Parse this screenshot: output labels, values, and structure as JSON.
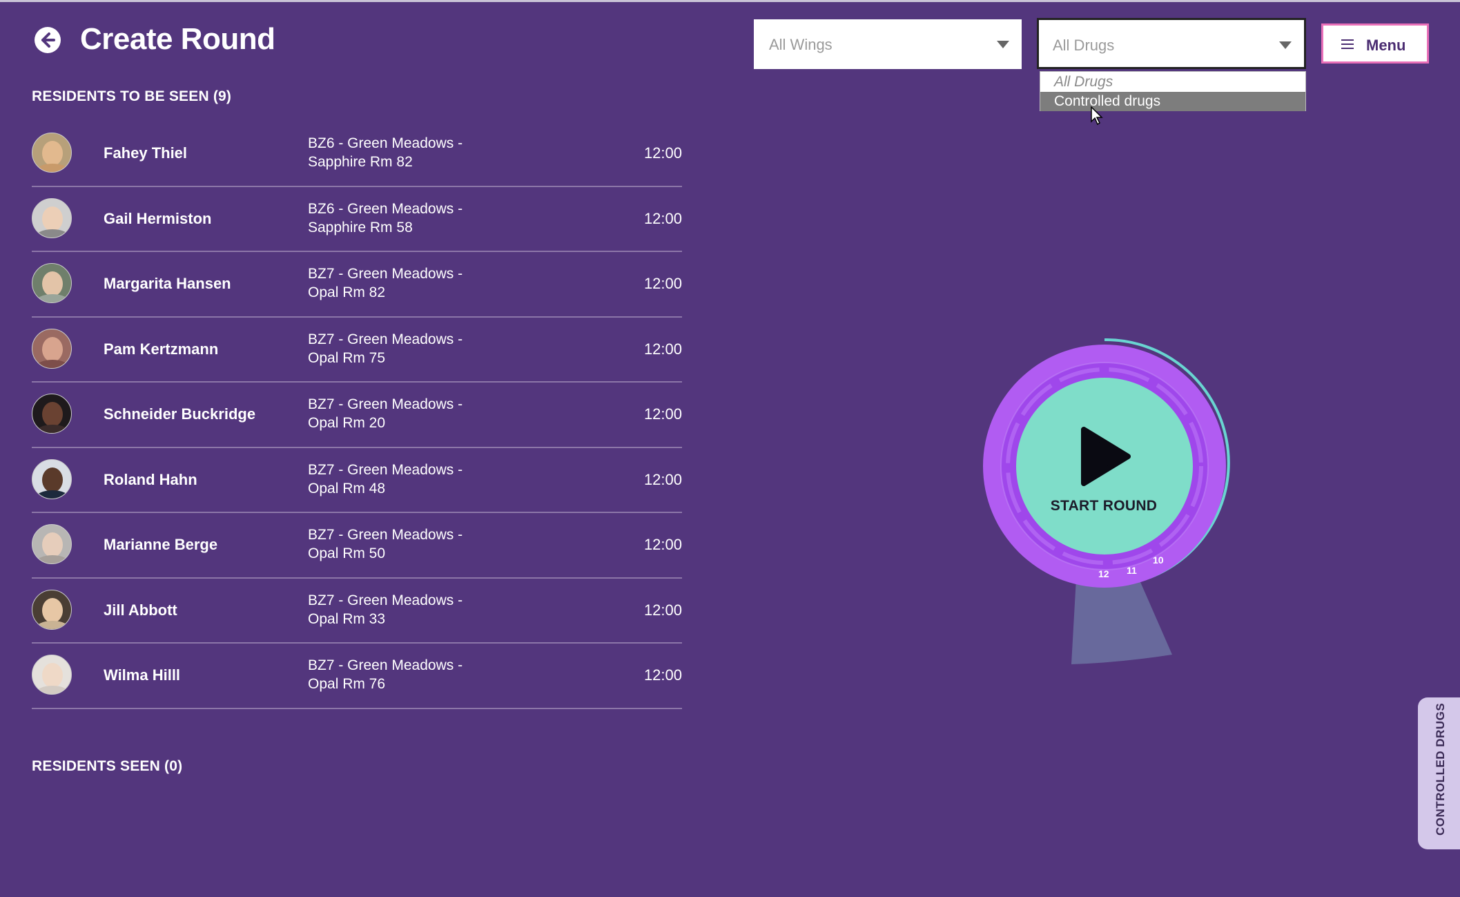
{
  "header": {
    "title": "Create Round",
    "back_icon": "arrow-left-icon"
  },
  "filters": {
    "wings": {
      "selected": "All Wings"
    },
    "drugs": {
      "selected": "All Drugs",
      "open": true,
      "options": [
        "All Drugs",
        "Controlled drugs"
      ],
      "highlighted": "Controlled drugs"
    }
  },
  "menu": {
    "label": "Menu",
    "icon": "hamburger-icon"
  },
  "residents_to_be_seen": {
    "title": "RESIDENTS TO BE SEEN (9)",
    "rows": [
      {
        "name": "Fahey Thiel",
        "location_line1": "BZ6 - Green Meadows -",
        "location_line2": "Sapphire Rm 82",
        "time": "12:00"
      },
      {
        "name": "Gail Hermiston",
        "location_line1": "BZ6 - Green Meadows -",
        "location_line2": "Sapphire Rm 58",
        "time": "12:00"
      },
      {
        "name": "Margarita Hansen",
        "location_line1": "BZ7 - Green Meadows -",
        "location_line2": "Opal Rm 82",
        "time": "12:00"
      },
      {
        "name": "Pam Kertzmann",
        "location_line1": "BZ7 - Green Meadows -",
        "location_line2": "Opal Rm 75",
        "time": "12:00"
      },
      {
        "name": "Schneider Buckridge",
        "location_line1": "BZ7 - Green Meadows -",
        "location_line2": "Opal Rm 20",
        "time": "12:00"
      },
      {
        "name": "Roland Hahn",
        "location_line1": "BZ7 - Green Meadows -",
        "location_line2": "Opal Rm 48",
        "time": "12:00"
      },
      {
        "name": "Marianne Berge",
        "location_line1": "BZ7 - Green Meadows -",
        "location_line2": "Opal Rm 50",
        "time": "12:00"
      },
      {
        "name": "Jill Abbott",
        "location_line1": "BZ7 - Green Meadows -",
        "location_line2": "Opal Rm 33",
        "time": "12:00"
      },
      {
        "name": "Wilma Hilll",
        "location_line1": "BZ7 - Green Meadows -",
        "location_line2": "Opal Rm 76",
        "time": "12:00"
      }
    ]
  },
  "residents_seen": {
    "title": "RESIDENTS SEEN (0)"
  },
  "start_round": {
    "label": "START ROUND",
    "icon": "play-icon",
    "ticks": [
      "12",
      "11",
      "10"
    ]
  },
  "side_tab": {
    "label": "CONTROLLED DRUGS"
  },
  "colors": {
    "background": "#53367d",
    "accent_pink": "#e96fb8",
    "teal": "#7fddc9",
    "ring_purple": "#a64df0"
  }
}
